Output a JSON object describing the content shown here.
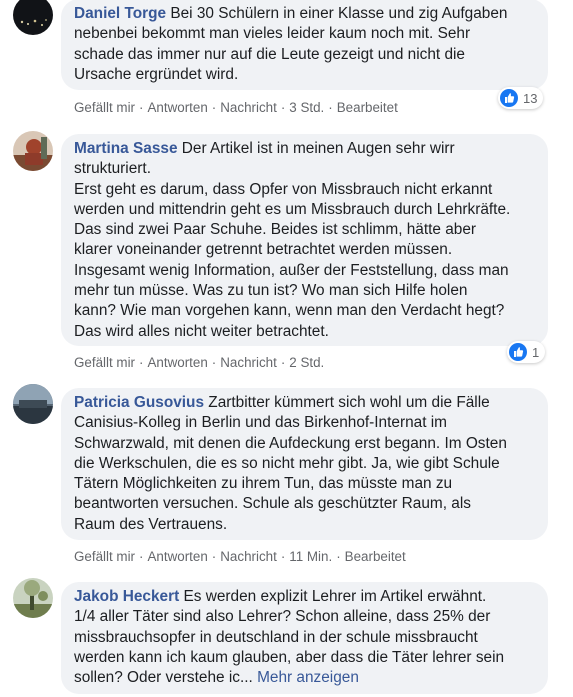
{
  "comments": [
    {
      "author": "Daniel Torge",
      "text": " Bei 30 Schülern in einer Klasse und zig Aufgaben\nnebenbei bekommt man vieles leider kaum noch mit. Sehr\nschade das immer nur auf die Leute gezeigt und nicht die\nUrsache ergründet wird.",
      "like_label": "Gefällt mir",
      "reply_label": "Antworten",
      "message_label": "Nachricht",
      "time": "3 Std.",
      "edited": "Bearbeitet",
      "reaction_count": "13"
    },
    {
      "author": "Martina Sasse",
      "text": " Der Artikel ist in meinen Augen sehr wirr\nstrukturiert.\nErst geht es darum, dass Opfer von Missbrauch nicht erkannt\nwerden und mittendrin geht es um Missbrauch durch Lehrkräfte.\nDas sind zwei Paar Schuhe. Beides ist schlimm, hätte aber\nklarer voneinander getrennt betrachtet werden müssen.\nInsgesamt wenig Information, außer der Feststellung, dass man\nmehr tun müsse. Was zu tun ist? Wo man sich Hilfe holen\nkann? Wie man vorgehen kann, wenn man den Verdacht hegt?\nDas wird alles nicht weiter betrachtet.",
      "like_label": "Gefällt mir",
      "reply_label": "Antworten",
      "message_label": "Nachricht",
      "time": "2 Std.",
      "reaction_count": "1"
    },
    {
      "author": "Patricia Gusovius",
      "text": " Zartbitter kümmert sich wohl um die Fälle\nCanisius-Kolleg in Berlin und das Birkenhof-Internat im\nSchwarzwald, mit denen die Aufdeckung erst begann. Im Osten\ndie Werkschulen, die es so nicht mehr gibt. Ja, wie gibt Schule\nTätern Möglichkeiten zu ihrem Tun, das müsste man zu\nbeantworten versuchen. Schule als geschützter Raum, als\nRaum des Vertrauens.",
      "like_label": "Gefällt mir",
      "reply_label": "Antworten",
      "message_label": "Nachricht",
      "time": "11 Min.",
      "edited": "Bearbeitet"
    },
    {
      "author": "Jakob Heckert",
      "text": " Es werden explizit Lehrer im Artikel erwähnt.\n1/4 aller Täter sind also Lehrer? Schon alleine, dass 25% der\nmissbrauchsopfer in deutschland in der schule missbraucht\nwerden kann ich kaum glauben, aber dass die Täter lehrer sein\nsollen? Oder verstehe ic...",
      "more_label": "Mehr anzeigen"
    }
  ],
  "separator": "·",
  "reaction_color": "#1877f2",
  "link_color": "#385898"
}
